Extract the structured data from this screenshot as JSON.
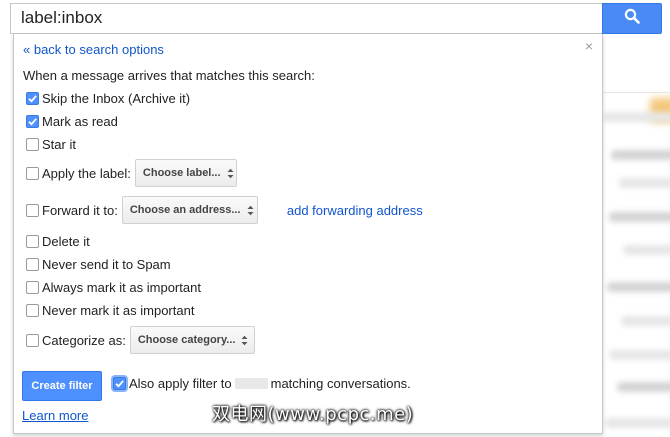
{
  "search": {
    "value": "label:inbox",
    "button_icon": "search-icon",
    "button_color": "#4a8af4"
  },
  "panel": {
    "back_link": "« back to search options",
    "close_icon": "close-icon",
    "intro": "When a message arrives that matches this search:"
  },
  "options": [
    {
      "label": "Skip the Inbox (Archive it)",
      "checked": true
    },
    {
      "label": "Mark as read",
      "checked": true
    },
    {
      "label": "Star it",
      "checked": false
    },
    {
      "label": "Apply the label:",
      "checked": false,
      "select": "Choose label..."
    },
    {
      "label": "Forward it to:",
      "checked": false,
      "select": "Choose an address...",
      "link": "add forwarding address"
    },
    {
      "label": "Delete it",
      "checked": false
    },
    {
      "label": "Never send it to Spam",
      "checked": false
    },
    {
      "label": "Always mark it as important",
      "checked": false
    },
    {
      "label": "Never mark it as important",
      "checked": false
    },
    {
      "label": "Categorize as:",
      "checked": false,
      "select": "Choose category..."
    }
  ],
  "footer": {
    "create_button": "Create filter",
    "also_apply_before": "Also apply filter to",
    "also_apply_after": "matching conversations.",
    "also_apply_checked": true,
    "learn_more": "Learn more"
  },
  "watermark": "双电网(www.pcpc.me)",
  "colors": {
    "link": "#1155cc",
    "checkbox_checked": "#4d90fe",
    "primary_button": "#4d90fe"
  }
}
